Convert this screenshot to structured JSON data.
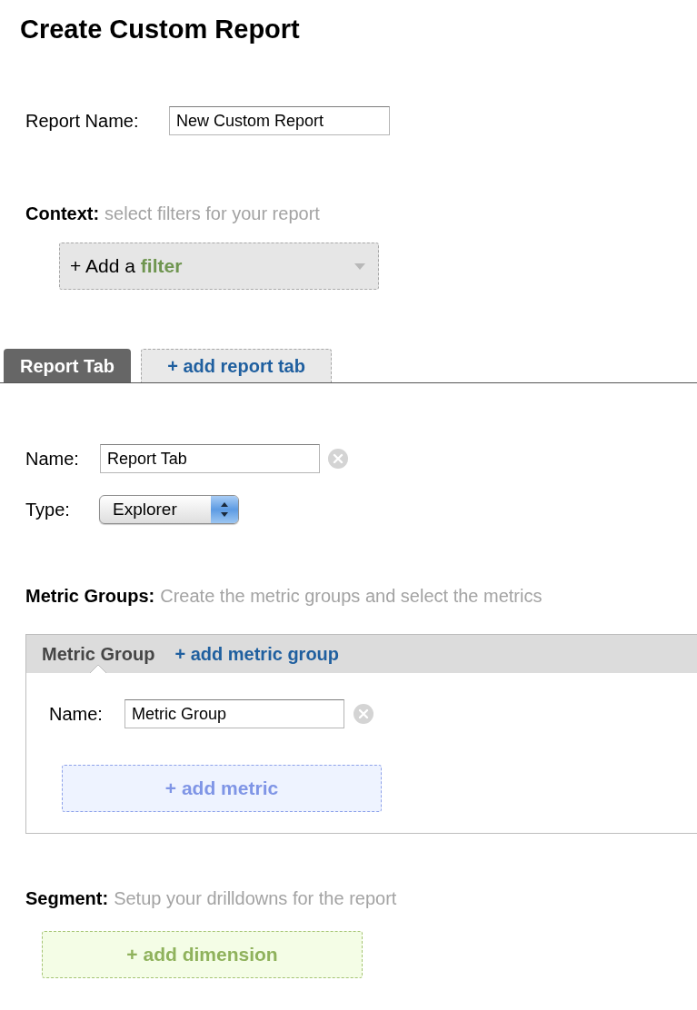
{
  "title": "Create Custom Report",
  "report_name": {
    "label": "Report Name:",
    "value": "New Custom Report"
  },
  "context": {
    "label": "Context:",
    "hint": "select filters for your report",
    "filter_dropdown": {
      "prefix": "+ Add a",
      "keyword": "filter"
    }
  },
  "tabs": [
    {
      "label": "Report Tab",
      "selected": true
    }
  ],
  "add_tab_button": "+ add report tab",
  "tab_settings": {
    "name": {
      "label": "Name:",
      "value": "Report Tab"
    },
    "type": {
      "label": "Type:",
      "value": "Explorer"
    }
  },
  "metric_groups": {
    "label": "Metric Groups:",
    "hint": "Create the metric groups and select the metrics",
    "tabs": [
      {
        "label": "Metric Group",
        "selected": true
      }
    ],
    "add_group_link": "+ add metric group",
    "name": {
      "label": "Name:",
      "value": "Metric Group"
    },
    "add_metric_button": "+ add metric"
  },
  "segment": {
    "label": "Segment:",
    "hint": "Setup your drilldowns for the report",
    "add_dimension_button": "+ add dimension"
  }
}
